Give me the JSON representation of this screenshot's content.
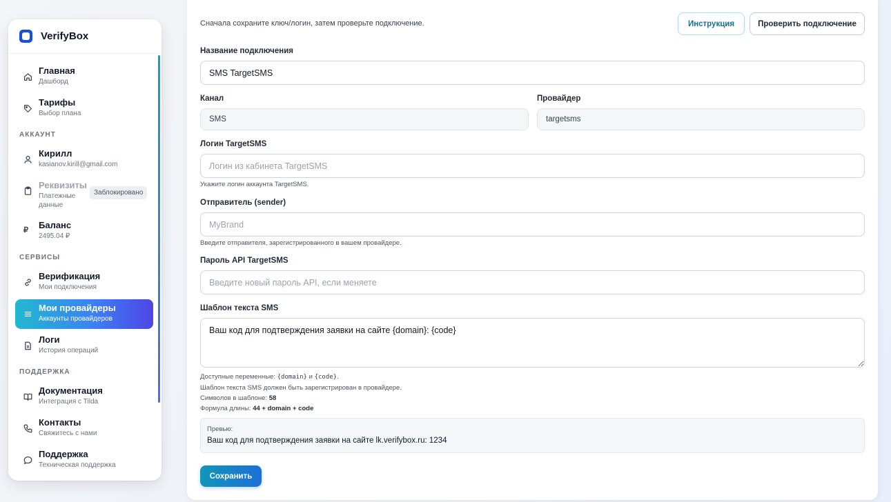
{
  "brand": {
    "name": "VerifyBox",
    "icon": "app-logo-icon"
  },
  "sidebar": {
    "items": [
      {
        "title": "Главная",
        "subtitle": "Дашборд",
        "icon": "home-icon"
      },
      {
        "title": "Тарифы",
        "subtitle": "Выбор плана",
        "icon": "tag-icon"
      },
      {
        "title": "Кирилл",
        "subtitle": "kasianov.kirill@gmail.com",
        "icon": "user-icon"
      },
      {
        "title": "Реквизиты",
        "subtitle": "Платежные данные",
        "icon": "clipboard-icon",
        "badge": "Заблокировано",
        "disabled": true
      },
      {
        "title": "Баланс",
        "subtitle": "2495.04 ₽",
        "icon": "ruble-icon"
      },
      {
        "title": "Верификация",
        "subtitle": "Мои подключения",
        "icon": "link-icon"
      },
      {
        "title": "Мои провайдеры",
        "subtitle": "Аккаунты провайдеров",
        "icon": "list-icon",
        "active": true
      },
      {
        "title": "Логи",
        "subtitle": "История операций",
        "icon": "file-icon"
      },
      {
        "title": "Документация",
        "subtitle": "Интеграция с Tilda",
        "icon": "book-icon"
      },
      {
        "title": "Контакты",
        "subtitle": "Свяжитесь с нами",
        "icon": "phone-icon"
      },
      {
        "title": "Поддержка",
        "subtitle": "Техническая поддержка",
        "icon": "chat-icon"
      }
    ],
    "sections": {
      "account": "АККАУНТ",
      "services": "СЕРВИСЫ",
      "support": "ПОДДЕРЖКА"
    }
  },
  "main": {
    "hint": "Сначала сохраните ключ/логин, затем проверьте подключение.",
    "instruction_button": "Инструкция",
    "check_button": "Проверить подключение",
    "connection_name": {
      "label": "Название подключения",
      "value": "SMS TargetSMS"
    },
    "channel": {
      "label": "Канал",
      "value": "SMS"
    },
    "provider": {
      "label": "Провайдер",
      "value": "targetsms"
    },
    "login": {
      "label": "Логин TargetSMS",
      "placeholder": "Логин из кабинета TargetSMS",
      "help": "Укажите логин аккаунта TargetSMS."
    },
    "sender": {
      "label": "Отправитель (sender)",
      "placeholder": "MyBrand",
      "help": "Введите отправителя, зарегистрированного в вашем провайдере."
    },
    "password": {
      "label": "Пароль API TargetSMS",
      "placeholder": "Введите новый пароль API, если меняете"
    },
    "template": {
      "label": "Шаблон текста SMS",
      "value": "Ваш код для подтверждения заявки на сайте {domain}: {code}",
      "vars_prefix": "Доступные переменные: ",
      "var_domain": "{domain}",
      "vars_and": " и ",
      "var_code": "{code}",
      "vars_suffix": ".",
      "registered_note": "Шаблон текста SMS должен быть зарегистрирован в провайдере.",
      "chars_label": "Символов в шаблоне: ",
      "chars_value": "58",
      "formula_label": "Формула длины: ",
      "formula_value": "44 + domain + code"
    },
    "preview": {
      "label": "Превью:",
      "text": "Ваш код для подтверждения заявки на сайте lk.verifybox.ru: 1234"
    },
    "save_button": "Сохранить"
  },
  "colors": {
    "accent": "#1d4ed8",
    "active_gradient_start": "#22b8cf",
    "active_gradient_end": "#4f46e5",
    "save_gradient_start": "#1196b8",
    "save_gradient_end": "#1d6fd8"
  }
}
